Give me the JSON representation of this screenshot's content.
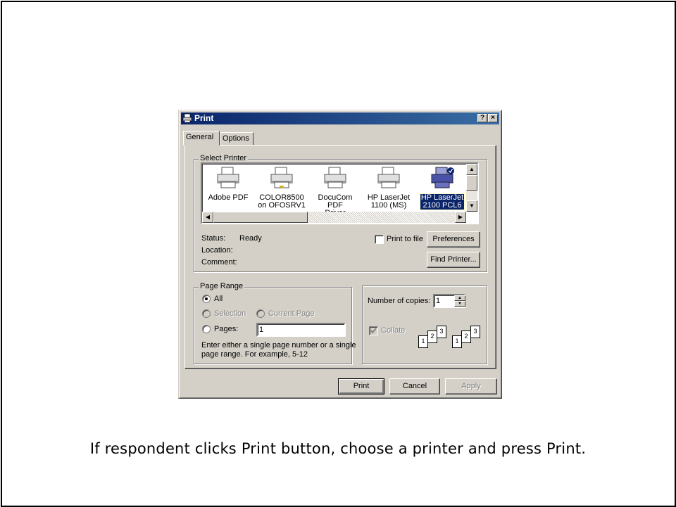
{
  "dialog": {
    "title": "Print",
    "help_button": "?",
    "close_button": "×",
    "tabs": [
      "General",
      "Options"
    ]
  },
  "select_printer": {
    "legend": "Select Printer",
    "printers": [
      {
        "line1": "Adobe PDF",
        "line2": ""
      },
      {
        "line1": "COLOR8500",
        "line2": "on OFOSRV1"
      },
      {
        "line1": "DocuCom PDF",
        "line2": "Driver"
      },
      {
        "line1": "HP LaserJet",
        "line2": "1100 (MS)"
      },
      {
        "line1": "HP LaserJet",
        "line2": "2100 PCL6"
      }
    ],
    "status_label": "Status:",
    "status_value": "Ready",
    "location_label": "Location:",
    "comment_label": "Comment:",
    "print_to_file_label": "Print to file",
    "preferences_button": "Preferences",
    "find_printer_button": "Find Printer..."
  },
  "page_range": {
    "legend": "Page Range",
    "all_label": "All",
    "selection_label": "Selection",
    "current_page_label": "Current Page",
    "pages_label": "Pages:",
    "pages_value": "1",
    "hint_line1": "Enter either a single page number or a single",
    "hint_line2": "page range.  For example, 5-12"
  },
  "copies": {
    "number_label": "Number of copies:",
    "number_value": "1",
    "collate_label": "Collate",
    "collate_pages": [
      "1",
      "2",
      "3"
    ]
  },
  "footer": {
    "print_button": "Print",
    "cancel_button": "Cancel",
    "apply_button": "Apply"
  },
  "caption": "If respondent clicks Print button, choose a printer and press Print.",
  "colors": {
    "title_bar": "#0a246a",
    "dialog_face": "#d4d0c8",
    "selection": "#0a246a"
  }
}
